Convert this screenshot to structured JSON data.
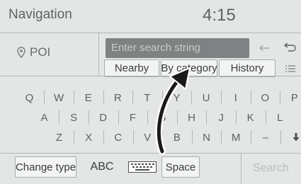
{
  "header": {
    "title": "Navigation",
    "clock": "4:15"
  },
  "poi": {
    "label": "POI",
    "icon": "location-pin-icon"
  },
  "search": {
    "placeholder": "Enter search string",
    "backspace_icon": "backspace-arrow-icon",
    "back_icon": "return-icon",
    "list_icon": "list-icon"
  },
  "tabs": [
    {
      "label": "Nearby"
    },
    {
      "label": "By category"
    },
    {
      "label": "History"
    }
  ],
  "keyboard": {
    "row1": [
      "Q",
      "W",
      "E",
      "R",
      "T",
      "Y",
      "U",
      "I",
      "O",
      "P"
    ],
    "row2": [
      "A",
      "S",
      "D",
      "F",
      "G",
      "H",
      "J",
      "K",
      "L"
    ],
    "row3": [
      "Z",
      "X",
      "C",
      "V",
      "B",
      "N",
      "M",
      "–"
    ],
    "shift_icon": "down-arrow-icon"
  },
  "footer": {
    "change_type": "Change type",
    "abc": "ABC",
    "keyboard_icon": "keyboard-icon",
    "space": "Space",
    "search": "Search"
  },
  "colors": {
    "panel": "#e4e6e6",
    "search_field": "#7f8282",
    "arrow": "#1a1a1a"
  }
}
